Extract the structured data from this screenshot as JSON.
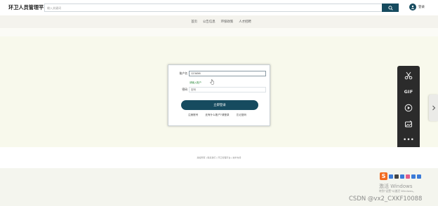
{
  "header": {
    "brand": "环卫人员管理平台",
    "search_placeholder": "输入关键词",
    "search_icon": "search-icon",
    "user_icon": "user-icon",
    "user_label": "登录"
  },
  "nav": {
    "items": [
      {
        "label": "首页"
      },
      {
        "label": "公告信息"
      },
      {
        "label": "环保政策"
      },
      {
        "label": "人才招聘"
      }
    ]
  },
  "login": {
    "account_label": "账户名",
    "account_value": "123456",
    "hint": "请输入账户",
    "password_label": "密码",
    "password_value": "密码",
    "submit_label": "立即登录",
    "links": [
      {
        "label": "注册账号"
      },
      {
        "label": "还有什么账户?请登录"
      },
      {
        "label": "忘记密码"
      }
    ]
  },
  "toolbar": {
    "tools": [
      {
        "icon": "scissors-icon"
      },
      {
        "icon": "gif-icon",
        "label": "GIF"
      },
      {
        "icon": "play-icon"
      },
      {
        "icon": "image-edit-icon"
      },
      {
        "icon": "more-icon",
        "label": "•••"
      }
    ]
  },
  "side_tab": {
    "icon": "chevron-right-icon"
  },
  "footer": {
    "text": "版权所有 | 联系我们 | 环卫管理平台 | 技术支持"
  },
  "overlay": {
    "ime_logo": "S",
    "watermark_title": "激活 Windows",
    "watermark_sub": "转到\"设置\"以激活 Windows。",
    "csdn": "CSDN @vx2_CXKF10088"
  }
}
